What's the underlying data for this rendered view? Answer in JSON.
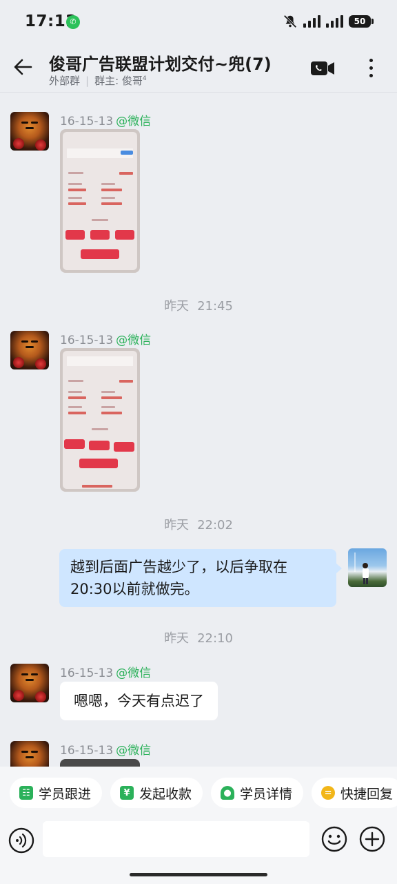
{
  "status_bar": {
    "time": "17:12",
    "wechat_badge": "✆",
    "battery": "50"
  },
  "header": {
    "back_icon": "arrow-left-icon",
    "title": "俊哥广告联盟计划交付~兜(7)",
    "subtitle_group": "外部群",
    "subtitle_owner_label": "群主: 俊哥",
    "subtitle_owner_sup": "4",
    "video_call_icon": "video-call-icon",
    "more_icon": "more-vertical-icon"
  },
  "messages": [
    {
      "type": "image",
      "sender": "16-15-13",
      "tag": "@微信"
    },
    {
      "type": "time",
      "day": "昨天",
      "time": "21:45"
    },
    {
      "type": "image",
      "sender": "16-15-13",
      "tag": "@微信"
    },
    {
      "type": "time",
      "day": "昨天",
      "time": "22:02"
    },
    {
      "type": "text-self",
      "lines": [
        "越到后面广告越少了，以后争取在",
        "20:30以前就做完。"
      ]
    },
    {
      "type": "time",
      "day": "昨天",
      "time": "22:10"
    },
    {
      "type": "text",
      "sender": "16-15-13",
      "tag": "@微信",
      "text": "嗯嗯，今天有点迟了"
    },
    {
      "type": "image",
      "sender": "16-15-13",
      "tag": "@微信"
    }
  ],
  "quick_actions": [
    {
      "label": "学员跟进",
      "icon": "student-follow-icon",
      "color": "#2bb15a"
    },
    {
      "label": "发起收款",
      "icon": "yuan-icon",
      "color": "#2bb15a"
    },
    {
      "label": "学员详情",
      "icon": "person-detail-icon",
      "color": "#2bb15a"
    },
    {
      "label": "快捷回复",
      "icon": "quick-reply-icon",
      "color": "#f2b619"
    }
  ],
  "input": {
    "placeholder": "",
    "voice_icon": "voice-icon",
    "emoji_icon": "emoji-icon",
    "plus_icon": "plus-circle-icon"
  }
}
